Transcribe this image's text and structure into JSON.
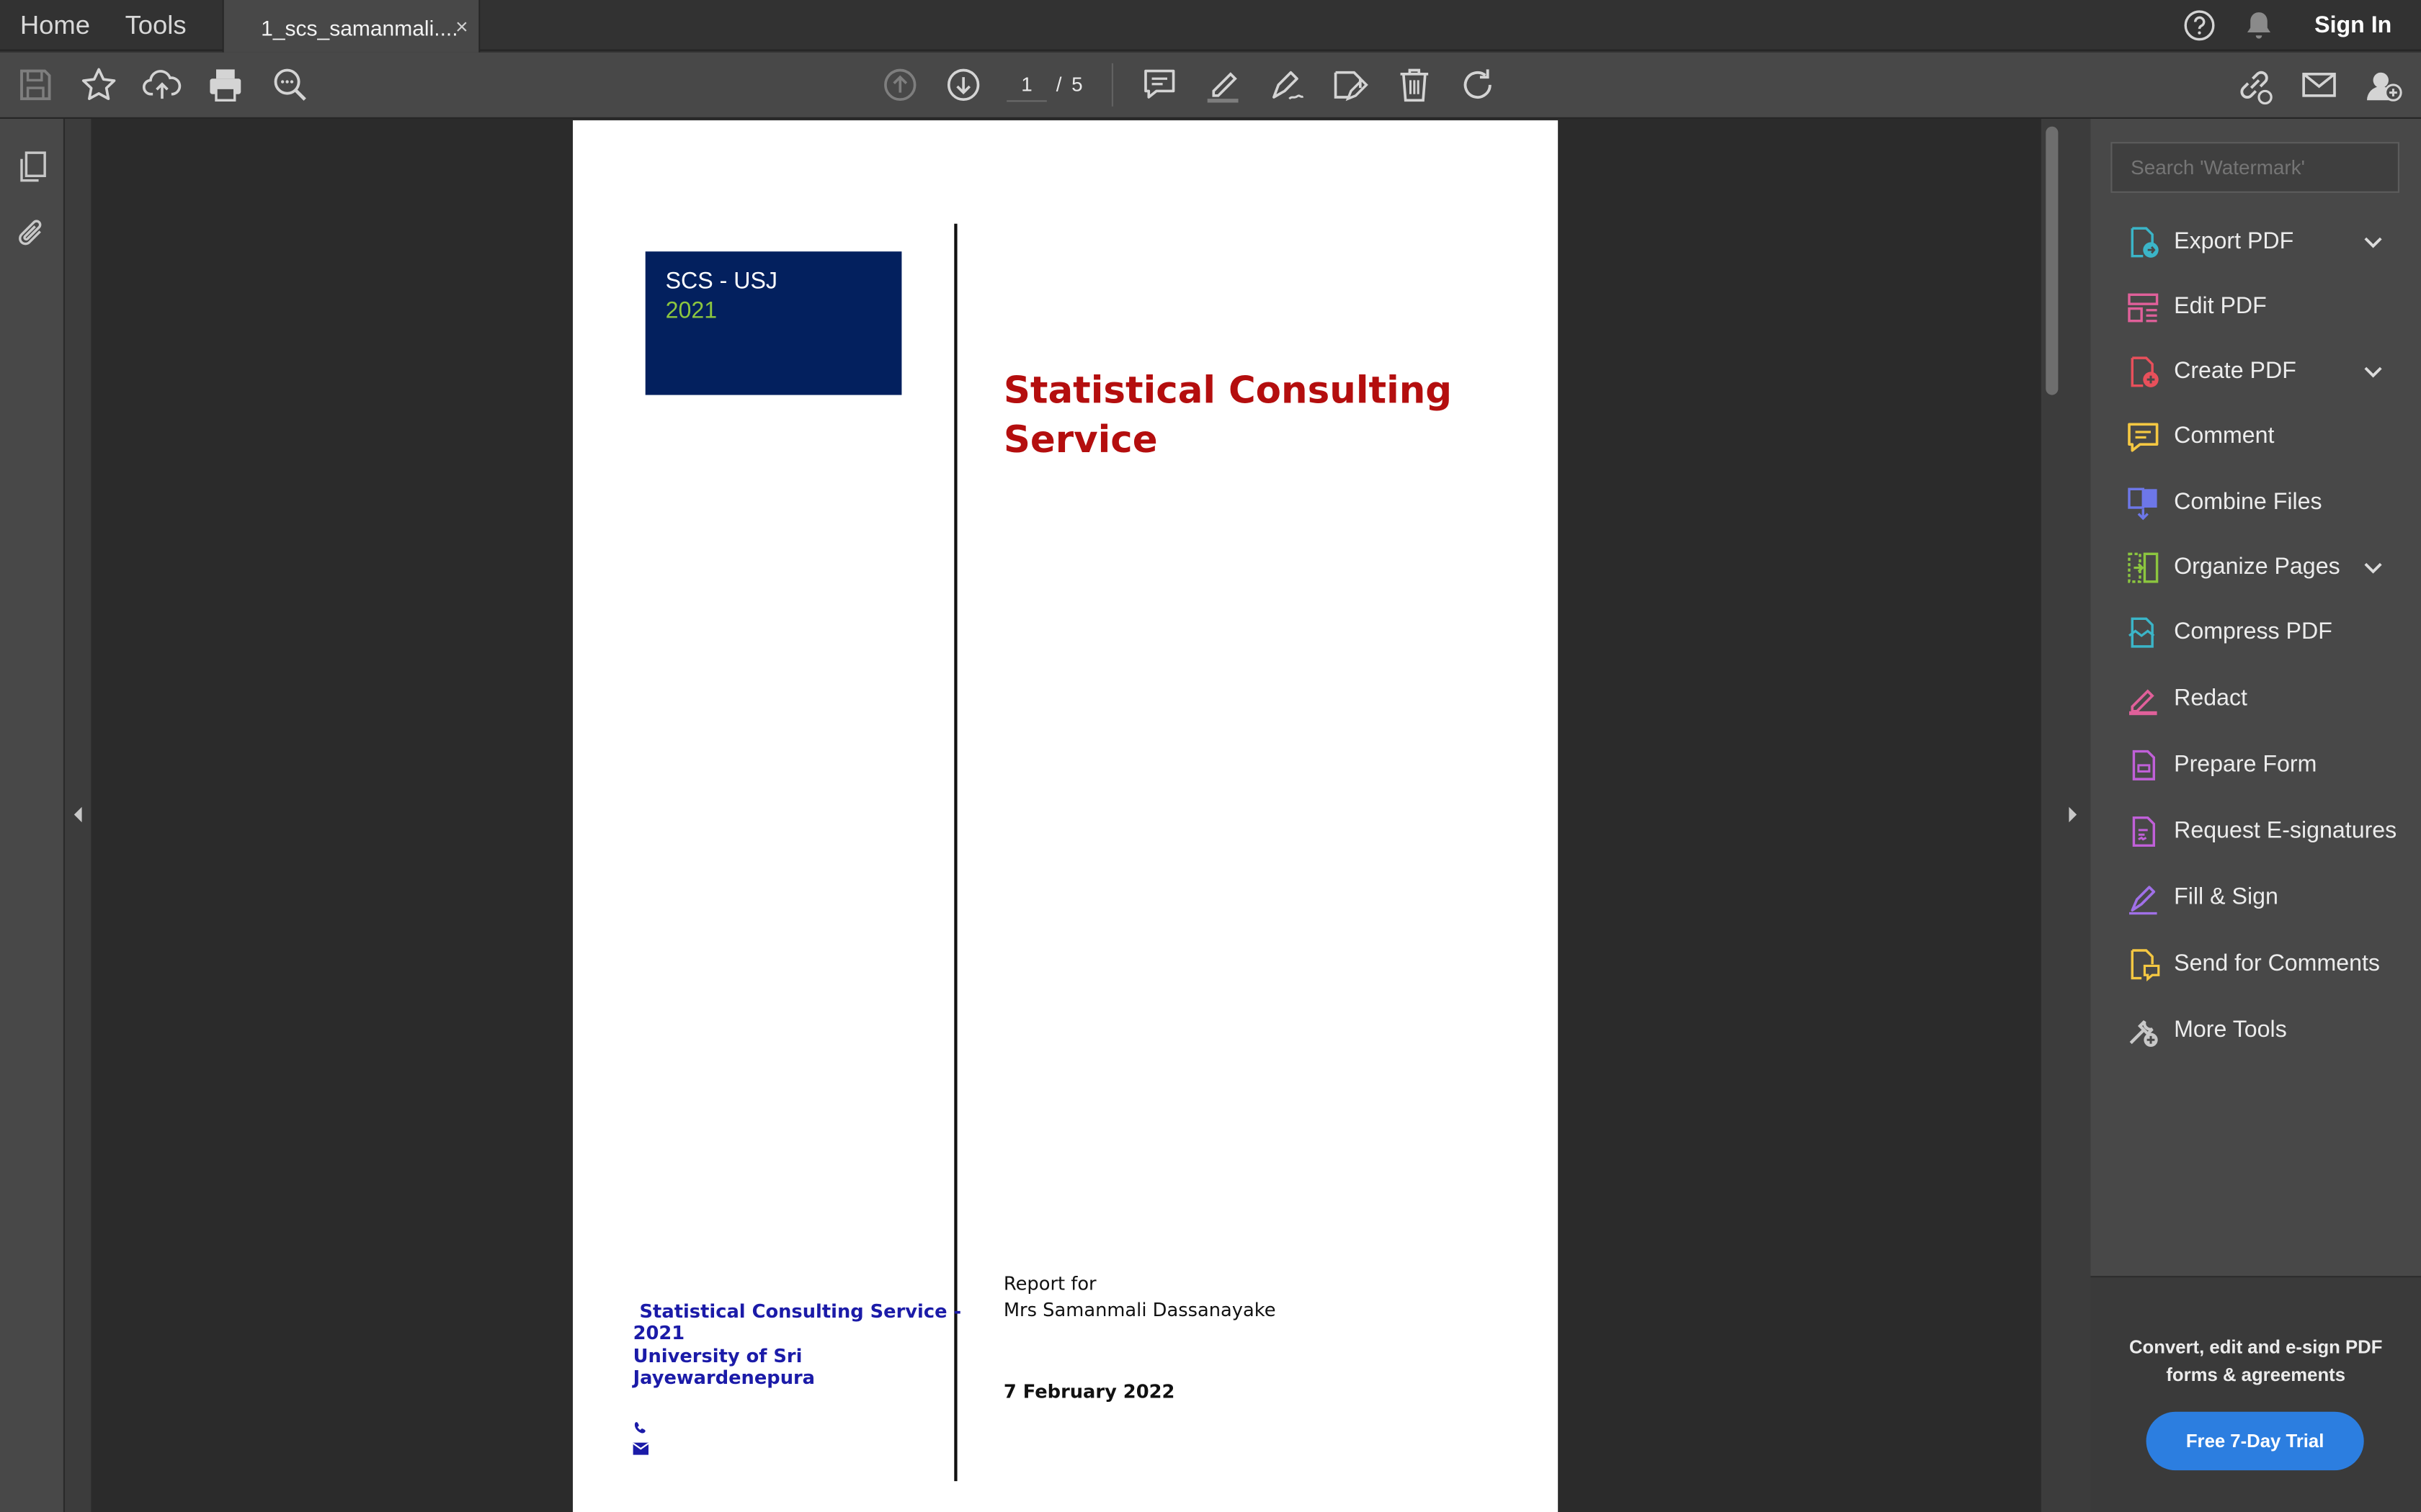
{
  "topbar": {
    "home_label": "Home",
    "tools_label": "Tools",
    "tab_title": "1_scs_samanmali....",
    "tab_close": "×",
    "signin_label": "Sign In"
  },
  "toolbar": {
    "current_page": "1",
    "page_separator": "/",
    "total_pages": "5",
    "icons": [
      "save-icon",
      "bookmark-star-icon",
      "upload-cloud-icon",
      "print-icon",
      "zoom-out-icon",
      "page-up-icon",
      "page-down-icon",
      "comment-icon",
      "highlight-icon",
      "draw-icon",
      "edit-text-icon",
      "delete-icon",
      "rotate-icon",
      "share-link-icon",
      "email-icon",
      "add-user-icon"
    ]
  },
  "right_panel": {
    "search_placeholder": "Search 'Watermark'",
    "tools": [
      {
        "label": "Export PDF",
        "icon": "export-pdf-icon",
        "color": "#3bb5c8",
        "has_chevron": true
      },
      {
        "label": "Edit PDF",
        "icon": "edit-pdf-icon",
        "color": "#e0609a",
        "has_chevron": false
      },
      {
        "label": "Create PDF",
        "icon": "create-pdf-icon",
        "color": "#e8505b",
        "has_chevron": true
      },
      {
        "label": "Comment",
        "icon": "comment-icon",
        "color": "#f5c842",
        "has_chevron": false
      },
      {
        "label": "Combine Files",
        "icon": "combine-files-icon",
        "color": "#6d77e8",
        "has_chevron": false
      },
      {
        "label": "Organize Pages",
        "icon": "organize-pages-icon",
        "color": "#8cc63f",
        "has_chevron": true
      },
      {
        "label": "Compress PDF",
        "icon": "compress-pdf-icon",
        "color": "#3bb5c8",
        "has_chevron": false
      },
      {
        "label": "Redact",
        "icon": "redact-icon",
        "color": "#e0609a",
        "has_chevron": false
      },
      {
        "label": "Prepare Form",
        "icon": "prepare-form-icon",
        "color": "#c060d8",
        "has_chevron": false
      },
      {
        "label": "Request E-signatures",
        "icon": "request-esign-icon",
        "color": "#c060d8",
        "has_chevron": false
      },
      {
        "label": "Fill & Sign",
        "icon": "fill-sign-icon",
        "color": "#a070e8",
        "has_chevron": false
      },
      {
        "label": "Send for Comments",
        "icon": "send-comments-icon",
        "color": "#f5c842",
        "has_chevron": false
      },
      {
        "label": "More Tools",
        "icon": "more-tools-icon",
        "color": "#c8c8c8",
        "has_chevron": false
      }
    ],
    "promo_text": "Convert, edit and e-sign PDF forms & agreements",
    "trial_button": "Free 7-Day Trial"
  },
  "document": {
    "logo_line1": "SCS - USJ",
    "logo_line2": "2021",
    "title": "Statistical Consulting Service",
    "org_line1": " Statistical Consulting Service -",
    "org_line2": "2021",
    "org_line3": "University of Sri",
    "org_line4": "Jayewardenepura",
    "report_for": "Report for",
    "report_name": "Mrs Samanmali Dassanayake",
    "report_date": "7 February 2022"
  },
  "colors": {
    "accent_blue": "#2c7ee0",
    "doc_title_red": "#b40e0e",
    "logo_navy": "#03205e",
    "logo_year_green": "#8cc63f",
    "org_text_blue": "#1b1ba8"
  }
}
